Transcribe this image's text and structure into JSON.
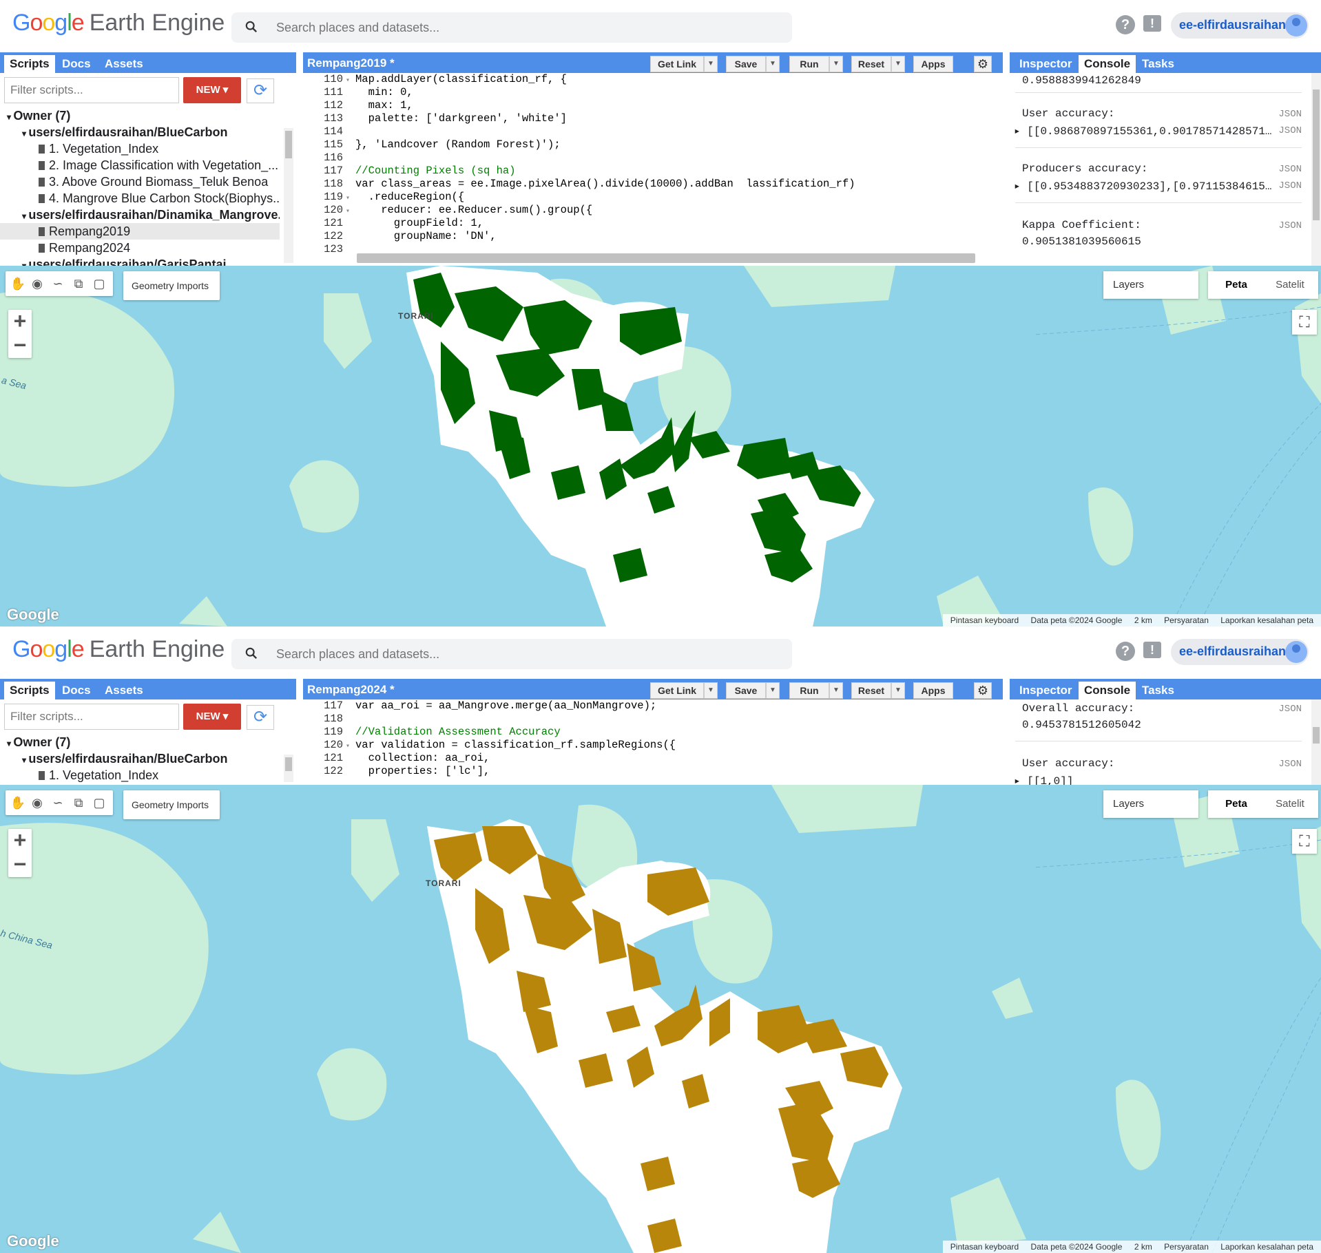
{
  "app": {
    "logo_google": "Google",
    "logo_product": "Earth Engine",
    "search_placeholder": "Search places and datasets...",
    "help_icon": "?",
    "feedback_icon": "!",
    "username": "ee-elfirdausraihan"
  },
  "scripts_panel": {
    "tabs": [
      "Scripts",
      "Docs",
      "Assets"
    ],
    "filter_placeholder": "Filter scripts...",
    "new_label": "NEW",
    "tree_top": [
      {
        "label": "Owner (7)",
        "type": "group"
      },
      {
        "label": "users/elfirdausraihan/BlueCarbon",
        "type": "repo"
      },
      {
        "label": "1. Vegetation_Index",
        "type": "file"
      },
      {
        "label": "2. Image Classification with Vegetation_...",
        "type": "file"
      },
      {
        "label": "3. Above Ground Biomass_Teluk Benoa",
        "type": "file"
      },
      {
        "label": "4. Mangrove Blue Carbon Stock(Biophys...",
        "type": "file"
      },
      {
        "label": "users/elfirdausraihan/Dinamika_Mangrove...",
        "type": "repo"
      },
      {
        "label": "Rempang2019",
        "type": "file",
        "selected": true
      },
      {
        "label": "Rempang2024",
        "type": "file"
      },
      {
        "label": "users/elfirdausraihan/GarisPantai",
        "type": "repo"
      }
    ],
    "tree_bottom": [
      {
        "label": "Owner (7)",
        "type": "group"
      },
      {
        "label": "users/elfirdausraihan/BlueCarbon",
        "type": "repo"
      },
      {
        "label": "1. Vegetation_Index",
        "type": "file"
      }
    ]
  },
  "editor_top": {
    "title": "Rempang2019 *",
    "buttons": {
      "get_link": "Get Link",
      "save": "Save",
      "run": "Run",
      "reset": "Reset",
      "apps": "Apps"
    },
    "lines": [
      {
        "n": "110",
        "fold": true,
        "html": "Map.addLayer(classification_rf, {"
      },
      {
        "n": "111",
        "fold": false,
        "html": "  min: 0,"
      },
      {
        "n": "112",
        "fold": false,
        "html": "  max: 1,"
      },
      {
        "n": "113",
        "fold": false,
        "html": "  palette: ['darkgreen', 'white']"
      },
      {
        "n": "114",
        "fold": false,
        "html": ""
      },
      {
        "n": "115",
        "fold": false,
        "html": "}, 'Landcover (Random Forest)');"
      },
      {
        "n": "116",
        "fold": false,
        "html": ""
      },
      {
        "n": "117",
        "fold": false,
        "html": "//Counting Pixels (sq ha)"
      },
      {
        "n": "118",
        "fold": false,
        "html": "var class_areas = ee.Image.pixelArea().divide(10000).addBan  lassification_rf)"
      },
      {
        "n": "119",
        "fold": true,
        "html": "  .reduceRegion({"
      },
      {
        "n": "120",
        "fold": true,
        "html": "    reducer: ee.Reducer.sum().group({"
      },
      {
        "n": "121",
        "fold": false,
        "html": "      groupField: 1,"
      },
      {
        "n": "122",
        "fold": false,
        "html": "      groupName: 'DN',"
      },
      {
        "n": "123",
        "fold": false,
        "html": ""
      }
    ]
  },
  "editor_bottom": {
    "title": "Rempang2024 *",
    "lines": [
      {
        "n": "117",
        "fold": false,
        "html": "var aa_roi = aa_Mangrove.merge(aa_NonMangrove);"
      },
      {
        "n": "118",
        "fold": false,
        "html": ""
      },
      {
        "n": "119",
        "fold": false,
        "html": "//Validation Assessment Accuracy"
      },
      {
        "n": "120",
        "fold": true,
        "html": "var validation = classification_rf.sampleRegions({"
      },
      {
        "n": "121",
        "fold": false,
        "html": "  collection: aa_roi,"
      },
      {
        "n": "122",
        "fold": false,
        "html": "  properties: ['lc'],"
      }
    ]
  },
  "console_panel": {
    "tabs": [
      "Inspector",
      "Console",
      "Tasks"
    ],
    "json_label": "JSON",
    "top": {
      "prev_value": "0.9588839941262849",
      "user_accuracy_label": "User accuracy:",
      "user_accuracy_value": "[[0.986870897155361,0.90178571428571…",
      "producers_label": "Producers accuracy:",
      "producers_value": "[[0.9534883720930233],[0.97115384615…",
      "kappa_label": "Kappa Coefficient:",
      "kappa_value": "0.9051381039560615"
    },
    "bottom": {
      "overall_label": "Overall accuracy:",
      "overall_value": "0.9453781512605042",
      "user_accuracy_label": "User accuracy:",
      "user_accuracy_value": "[[1,0]]"
    }
  },
  "map": {
    "geometry_imports": "Geometry Imports",
    "layers": "Layers",
    "map_type": [
      "Peta",
      "Satelit"
    ],
    "zoom_in": "+",
    "zoom_out": "−",
    "google_logo": "Google",
    "place_label": "TORARI",
    "sea_label_top": "a Sea",
    "sea_label_bottom": "h China Sea",
    "attribution": [
      "Pintasan keyboard",
      "Data peta ©2024 Google",
      "2 km",
      "Persyaratan",
      "Laporkan kesalahan peta"
    ],
    "colors": {
      "water": "#8fd3e8",
      "land": "#c9eed9",
      "classified_2019": "#006400",
      "classified_2024": "#b8860b"
    }
  }
}
